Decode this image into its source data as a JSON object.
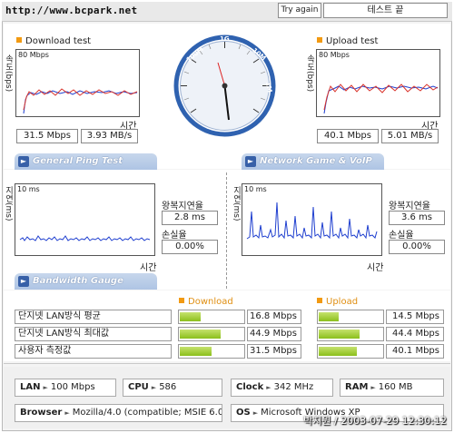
{
  "header": {
    "url": "http://www.bcpark.net",
    "retry_label": "Try again",
    "end_label": "테스트 끝"
  },
  "download": {
    "title": "Download test",
    "scale": "80 Mbps",
    "ylabel": "속도(bps)",
    "xlabel": "시간",
    "mbps": "31.5 Mbps",
    "mbs": "3.93 MB/s"
  },
  "upload": {
    "title": "Upload test",
    "scale": "80 Mbps",
    "ylabel": "속도(bps)",
    "xlabel": "시간",
    "mbps": "40.1 Mbps",
    "mbs": "5.01 MB/s"
  },
  "gauge": {
    "labels": [
      "100M",
      "1G",
      "10M",
      "1M"
    ]
  },
  "ping": {
    "tab": "General Ping Test",
    "scale": "10 ms",
    "ylabel": "지연(ms)",
    "xlabel": "시간",
    "rtt_label": "왕복지연율",
    "rtt": "2.8 ms",
    "loss_label": "손실율",
    "loss": "0.00%"
  },
  "game": {
    "tab": "Network Game & VoIP Test",
    "scale": "10 ms",
    "ylabel": "지연(ms)",
    "xlabel": "시간",
    "rtt_label": "왕복지연율",
    "rtt": "3.6 ms",
    "loss_label": "손실율",
    "loss": "0.00%"
  },
  "bandwidth": {
    "tab": "Bandwidth Gauge",
    "download_title": "Download",
    "upload_title": "Upload",
    "rows": [
      {
        "label": "단지넷 LAN방식 평균",
        "down": "16.8 Mbps",
        "down_level": 0.19,
        "up": "14.5 Mbps",
        "up_level": 0.17
      },
      {
        "label": "단지넷 LAN방식 최대값",
        "down": "44.9 Mbps",
        "down_level": 0.5,
        "up": "44.4 Mbps",
        "up_level": 0.5
      },
      {
        "label": "사용자 측정값",
        "down": "31.5 Mbps",
        "down_level": 0.35,
        "up": "40.1 Mbps",
        "up_level": 0.45
      }
    ]
  },
  "sysinfo": {
    "lan_key": "LAN",
    "lan": "100 Mbps",
    "cpu_key": "CPU",
    "cpu": "586",
    "clock_key": "Clock",
    "clock": "342 MHz",
    "ram_key": "RAM",
    "ram": "160 MB",
    "browser_key": "Browser",
    "browser": "Mozilla/4.0 (compatible; MSIE 6.0",
    "os_key": "OS",
    "os": "Microsoft Windows XP"
  },
  "stamp": "박지원 / 2003-07-29 12:30:12",
  "colors": {
    "tab": "#aec4e4",
    "bar": "#8bbf1c",
    "accent": "#f29a12",
    "gauge_ring": "#2f62b0"
  }
}
